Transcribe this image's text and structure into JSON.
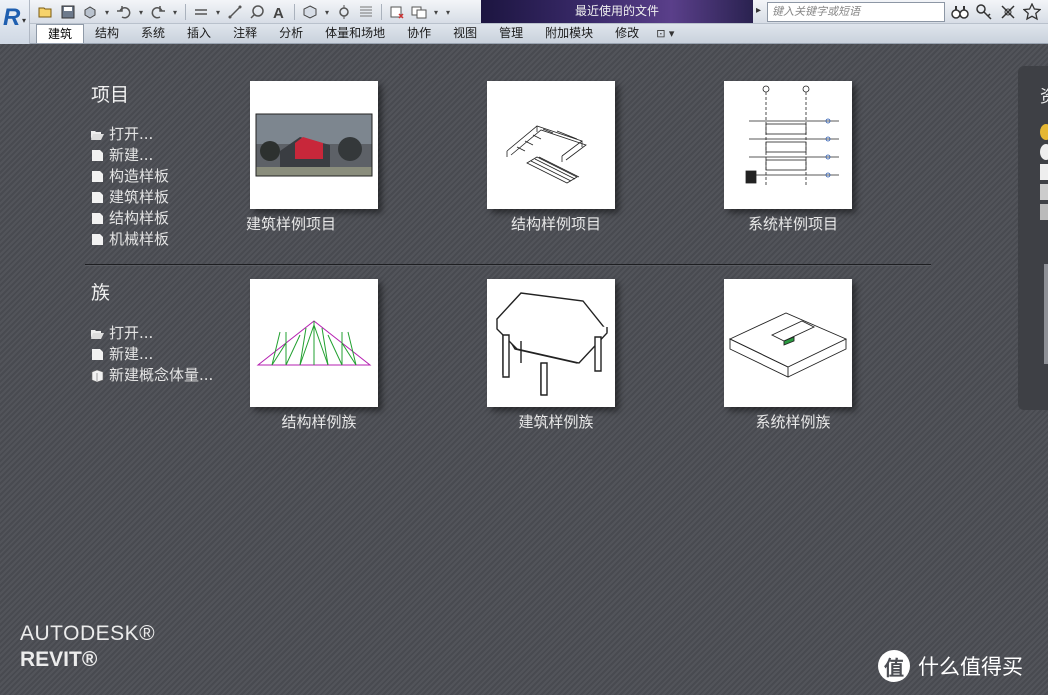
{
  "quick_access": {
    "title": "最近使用的文件",
    "search_placeholder": "键入关键字或短语",
    "icons": [
      "open-icon",
      "save-icon",
      "sync-icon",
      "undo-icon",
      "redo-icon",
      "measure-icon",
      "dimension-icon",
      "tag-icon",
      "text-icon",
      "3d-view-icon",
      "section-icon",
      "thin-lines-icon",
      "close-hidden-icon",
      "switch-windows-icon",
      "customize-icon"
    ],
    "right_icons": [
      "binoculars-icon",
      "key-icon",
      "exchange-icon",
      "star-icon"
    ]
  },
  "ribbon": {
    "tabs": [
      "建筑",
      "结构",
      "系统",
      "插入",
      "注释",
      "分析",
      "体量和场地",
      "协作",
      "视图",
      "管理",
      "附加模块",
      "修改"
    ],
    "active_tab": "建筑"
  },
  "projects": {
    "title": "项目",
    "links": [
      {
        "label": "打开...",
        "icon": "folder-open-icon"
      },
      {
        "label": "新建...",
        "icon": "new-file-icon"
      },
      {
        "label": "构造样板",
        "icon": "template-icon"
      },
      {
        "label": "建筑样板",
        "icon": "template-icon"
      },
      {
        "label": "结构样板",
        "icon": "template-icon"
      },
      {
        "label": "机械样板",
        "icon": "template-icon"
      }
    ],
    "thumbnails": [
      {
        "label": "建筑样例项目"
      },
      {
        "label": "结构样例项目"
      },
      {
        "label": "系统样例项目"
      }
    ]
  },
  "families": {
    "title": "族",
    "links": [
      {
        "label": "打开...",
        "icon": "folder-open-icon"
      },
      {
        "label": "新建...",
        "icon": "new-file-icon"
      },
      {
        "label": "新建概念体量...",
        "icon": "mass-icon"
      }
    ],
    "thumbnails": [
      {
        "label": "结构样例族"
      },
      {
        "label": "建筑样例族"
      },
      {
        "label": "系统样例族"
      }
    ]
  },
  "side_panel": {
    "title": "资"
  },
  "brand": {
    "company": "AUTODESK®",
    "product": "REVIT®"
  },
  "watermark": {
    "logo_char": "值",
    "text": "什么值得买"
  }
}
